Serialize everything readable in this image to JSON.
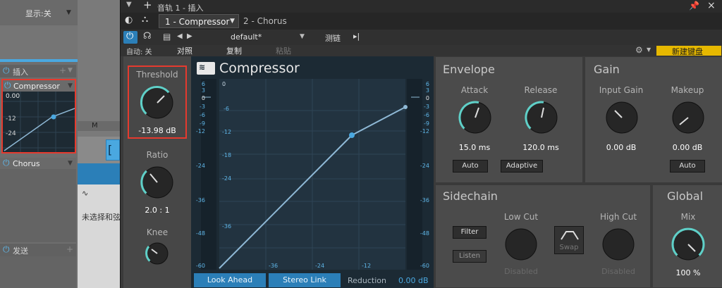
{
  "left": {
    "display_off": "显示:关",
    "insert_label": "插入",
    "compressor_label": "Compressor",
    "mini_ticks": [
      "0.00",
      "-12",
      "-24"
    ],
    "chorus_label": "Chorus",
    "send_label": "发送",
    "m_label": "M",
    "no_selection": "未选择和弦",
    "bracket": "["
  },
  "window": {
    "title": "音轨 1 - 插入",
    "tabs": [
      "1 - Compressor",
      "2 - Chorus"
    ],
    "preset": "default*",
    "test_chain": "测链",
    "auto_off": "自动: 关",
    "compare": "对照",
    "copy": "复制",
    "paste": "粘贴",
    "new_keyboard": "新建键盘"
  },
  "plugin": {
    "brand": "Compressor",
    "threshold": {
      "label": "Threshold",
      "value": "-13.98 dB",
      "level": 0.72
    },
    "ratio": {
      "label": "Ratio",
      "value": "2.0 : 1",
      "level": 0.18
    },
    "knee": {
      "label": "Knee",
      "level": 0.3
    },
    "graph_left_ticks": [
      "6",
      "3",
      "0",
      "-3",
      "-6",
      "-9",
      "-12",
      "-18",
      "-24",
      "-36",
      "-48",
      "-60"
    ],
    "graph_inner_y": [
      "0",
      "-6",
      "-12",
      "-18",
      "-24",
      "-36",
      "-48",
      "-60"
    ],
    "graph_inner_x": [
      "-36",
      "-24",
      "-12"
    ],
    "look_ahead": "Look Ahead",
    "stereo_link": "Stereo Link",
    "reduction_label": "Reduction",
    "reduction_value": "0.00 dB"
  },
  "envelope": {
    "title": "Envelope",
    "attack": {
      "label": "Attack",
      "value": "15.0 ms",
      "level": 0.58
    },
    "release": {
      "label": "Release",
      "value": "120.0 ms",
      "level": 0.52
    },
    "auto": "Auto",
    "adaptive": "Adaptive"
  },
  "gain": {
    "title": "Gain",
    "input_gain": {
      "label": "Input Gain",
      "value": "0.00 dB"
    },
    "makeup": {
      "label": "Makeup",
      "value": "0.00 dB"
    },
    "auto": "Auto"
  },
  "sidechain": {
    "title": "Sidechain",
    "filter": "Filter",
    "listen": "Listen",
    "low_cut": {
      "label": "Low Cut",
      "value": "Disabled"
    },
    "high_cut": {
      "label": "High Cut",
      "value": "Disabled"
    },
    "swap": "Swap"
  },
  "global": {
    "title": "Global",
    "mix": {
      "label": "Mix",
      "value": "100 %",
      "level": 1.0
    }
  }
}
